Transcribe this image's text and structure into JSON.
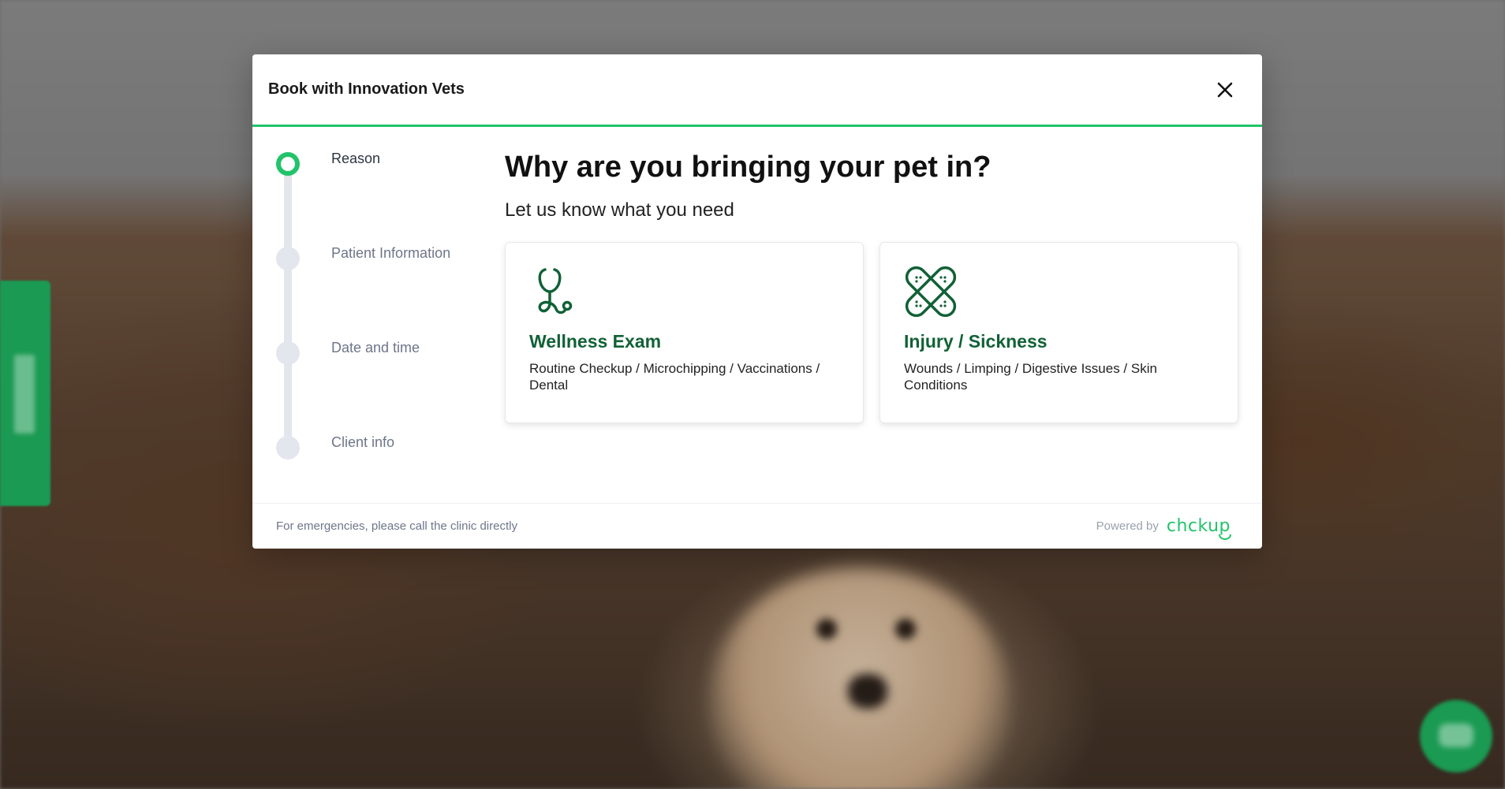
{
  "modal": {
    "title": "Book with Innovation Vets"
  },
  "stepper": {
    "steps": [
      {
        "label": "Reason",
        "active": true
      },
      {
        "label": "Patient Information",
        "active": false
      },
      {
        "label": "Date and time",
        "active": false
      },
      {
        "label": "Client info",
        "active": false
      }
    ]
  },
  "content": {
    "heading": "Why are you bringing your pet in?",
    "subheading": "Let us know what you need",
    "cards": [
      {
        "icon": "stethoscope-icon",
        "title": "Wellness Exam",
        "description": "Routine Checkup / Microchipping / Vaccinations / Dental"
      },
      {
        "icon": "bandage-icon",
        "title": "Injury / Sickness",
        "description": "Wounds / Limping / Digestive Issues / Skin Conditions"
      }
    ]
  },
  "footer": {
    "note": "For emergencies, please call the clinic directly",
    "powered_by": "Powered by",
    "brand": "chckup"
  },
  "colors": {
    "accent": "#22c36a",
    "card_title": "#116136",
    "side_tab": "#1a9a52"
  }
}
